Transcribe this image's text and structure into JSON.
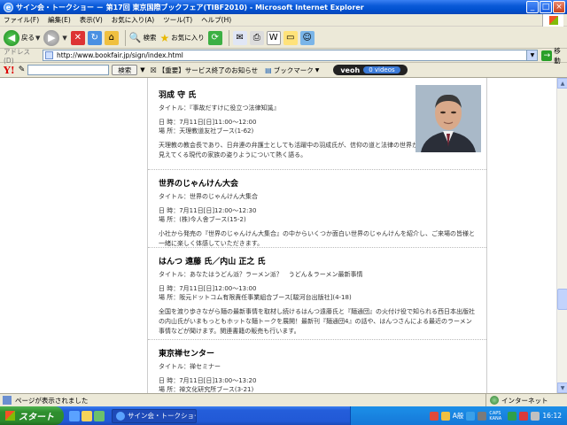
{
  "window": {
    "title": "サイン会・トークショー － 第17回 東京国際ブックフェア(TIBF2010) - Microsoft Internet Explorer",
    "min_label": "_",
    "max_label": "□",
    "close_label": "×"
  },
  "menu": [
    "ファイル(F)",
    "編集(E)",
    "表示(V)",
    "お気に入り(A)",
    "ツール(T)",
    "ヘルプ(H)"
  ],
  "toolbar": {
    "back_label": "戻る",
    "search_label": "検索",
    "favorites_label": "お気に入り"
  },
  "address": {
    "label": "アドレス(D)",
    "url": "http://www.bookfair.jp/sign/index.html",
    "go_label": "移動"
  },
  "yahoo": {
    "logo": "Y!",
    "search_button": "検索",
    "notice": "【重要】サービス終了のお知らせ",
    "bookmark": "ブックマーク",
    "veoh": "veoh",
    "veoh_videos": "0 videos"
  },
  "events": [
    {
      "name": "羽成 守 氏",
      "title": "タイトル：『事故だすけに役立つ法律知識』",
      "datetime": "日 時：7月11日[日]11:00～12:00",
      "place": "場 所：天理教道友社ブース(1-62)",
      "desc": "天理教の教会長であり、日弁連の弁護士としても活躍中の羽成氏が、信仰の道と法律の世界から見えてくる現代の家族の姿りようについて熱く語る。"
    },
    {
      "name": "世界のじゃんけん大会",
      "title": "タイトル：世界のじゃんけん大集合",
      "datetime": "日 時：7月11日[日]12:00～12:30",
      "place": "場 所：(株)今人舎ブース(15-2)",
      "desc": "小社から発売の『世界のじゃんけん大集合』の中からいくつか面白い世界のじゃんけんを紹介し、ご来場の皆様と一緒に楽しく体感していただきます。"
    },
    {
      "name": "はんつ 遠藤 氏／内山 正之 氏",
      "title": "タイトル：あなたはうどん派？ラーメン派？　うどん＆ラーメン最新事情",
      "datetime": "日 時：7月11日[日]12:00～13:00",
      "place": "場 所：阪元ドットコム有限責任事業組合ブース[駿河台出版社](4-18)",
      "desc": "全国を渡り歩きながら麺の最新事情を取材し続けるはんつ遠藤氏と『麺通団』の火付け役で知られる西日本出版社の内山氏がいまもっともホットな麺トークを展開！最新刊『麺通団4』の話や、はんつさんによる最近のラーメン事情などが聞けます。関連書籍の販売も行います。"
    },
    {
      "name": "東京禅センター",
      "title": "タイトル：禅セミナー",
      "datetime": "日 時：7月11日[日]13:00～13:20",
      "place": "場 所：禅文化研究所ブース(3-21)"
    }
  ],
  "status": {
    "text": "ページが表示されました",
    "zone": "インターネット"
  },
  "taskbar": {
    "start": "スタート",
    "task": "サイン会・トークショー -...",
    "ime": "A般",
    "caps": "CAPS KANA",
    "clock": "16:12"
  }
}
